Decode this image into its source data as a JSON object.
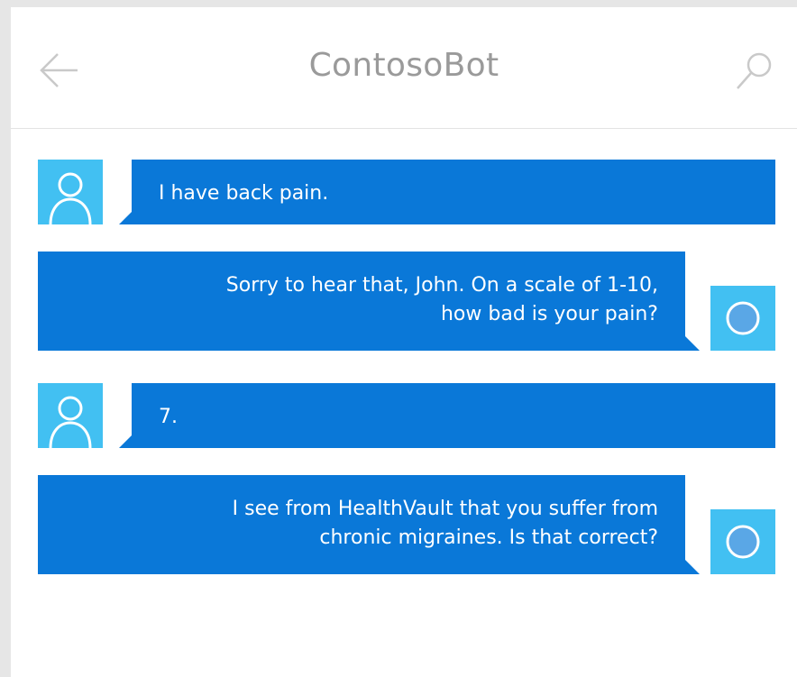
{
  "header": {
    "title": "ContosoBot",
    "back_icon": "arrow-left-icon",
    "search_icon": "search-icon"
  },
  "colors": {
    "bubble": "#0a78d8",
    "avatar": "#42c0f2",
    "title": "#9a9a9a"
  },
  "messages": [
    {
      "sender": "user",
      "avatar_icon": "user-icon",
      "text": "I have back pain."
    },
    {
      "sender": "bot",
      "avatar_icon": "bot-icon",
      "text": "Sorry to hear that, John. On a scale of 1-10,\nhow bad is your pain?"
    },
    {
      "sender": "user",
      "avatar_icon": "user-icon",
      "text": "7."
    },
    {
      "sender": "bot",
      "avatar_icon": "bot-icon",
      "text": "I see from HealthVault that you suffer from\nchronic migraines. Is that correct?"
    }
  ]
}
